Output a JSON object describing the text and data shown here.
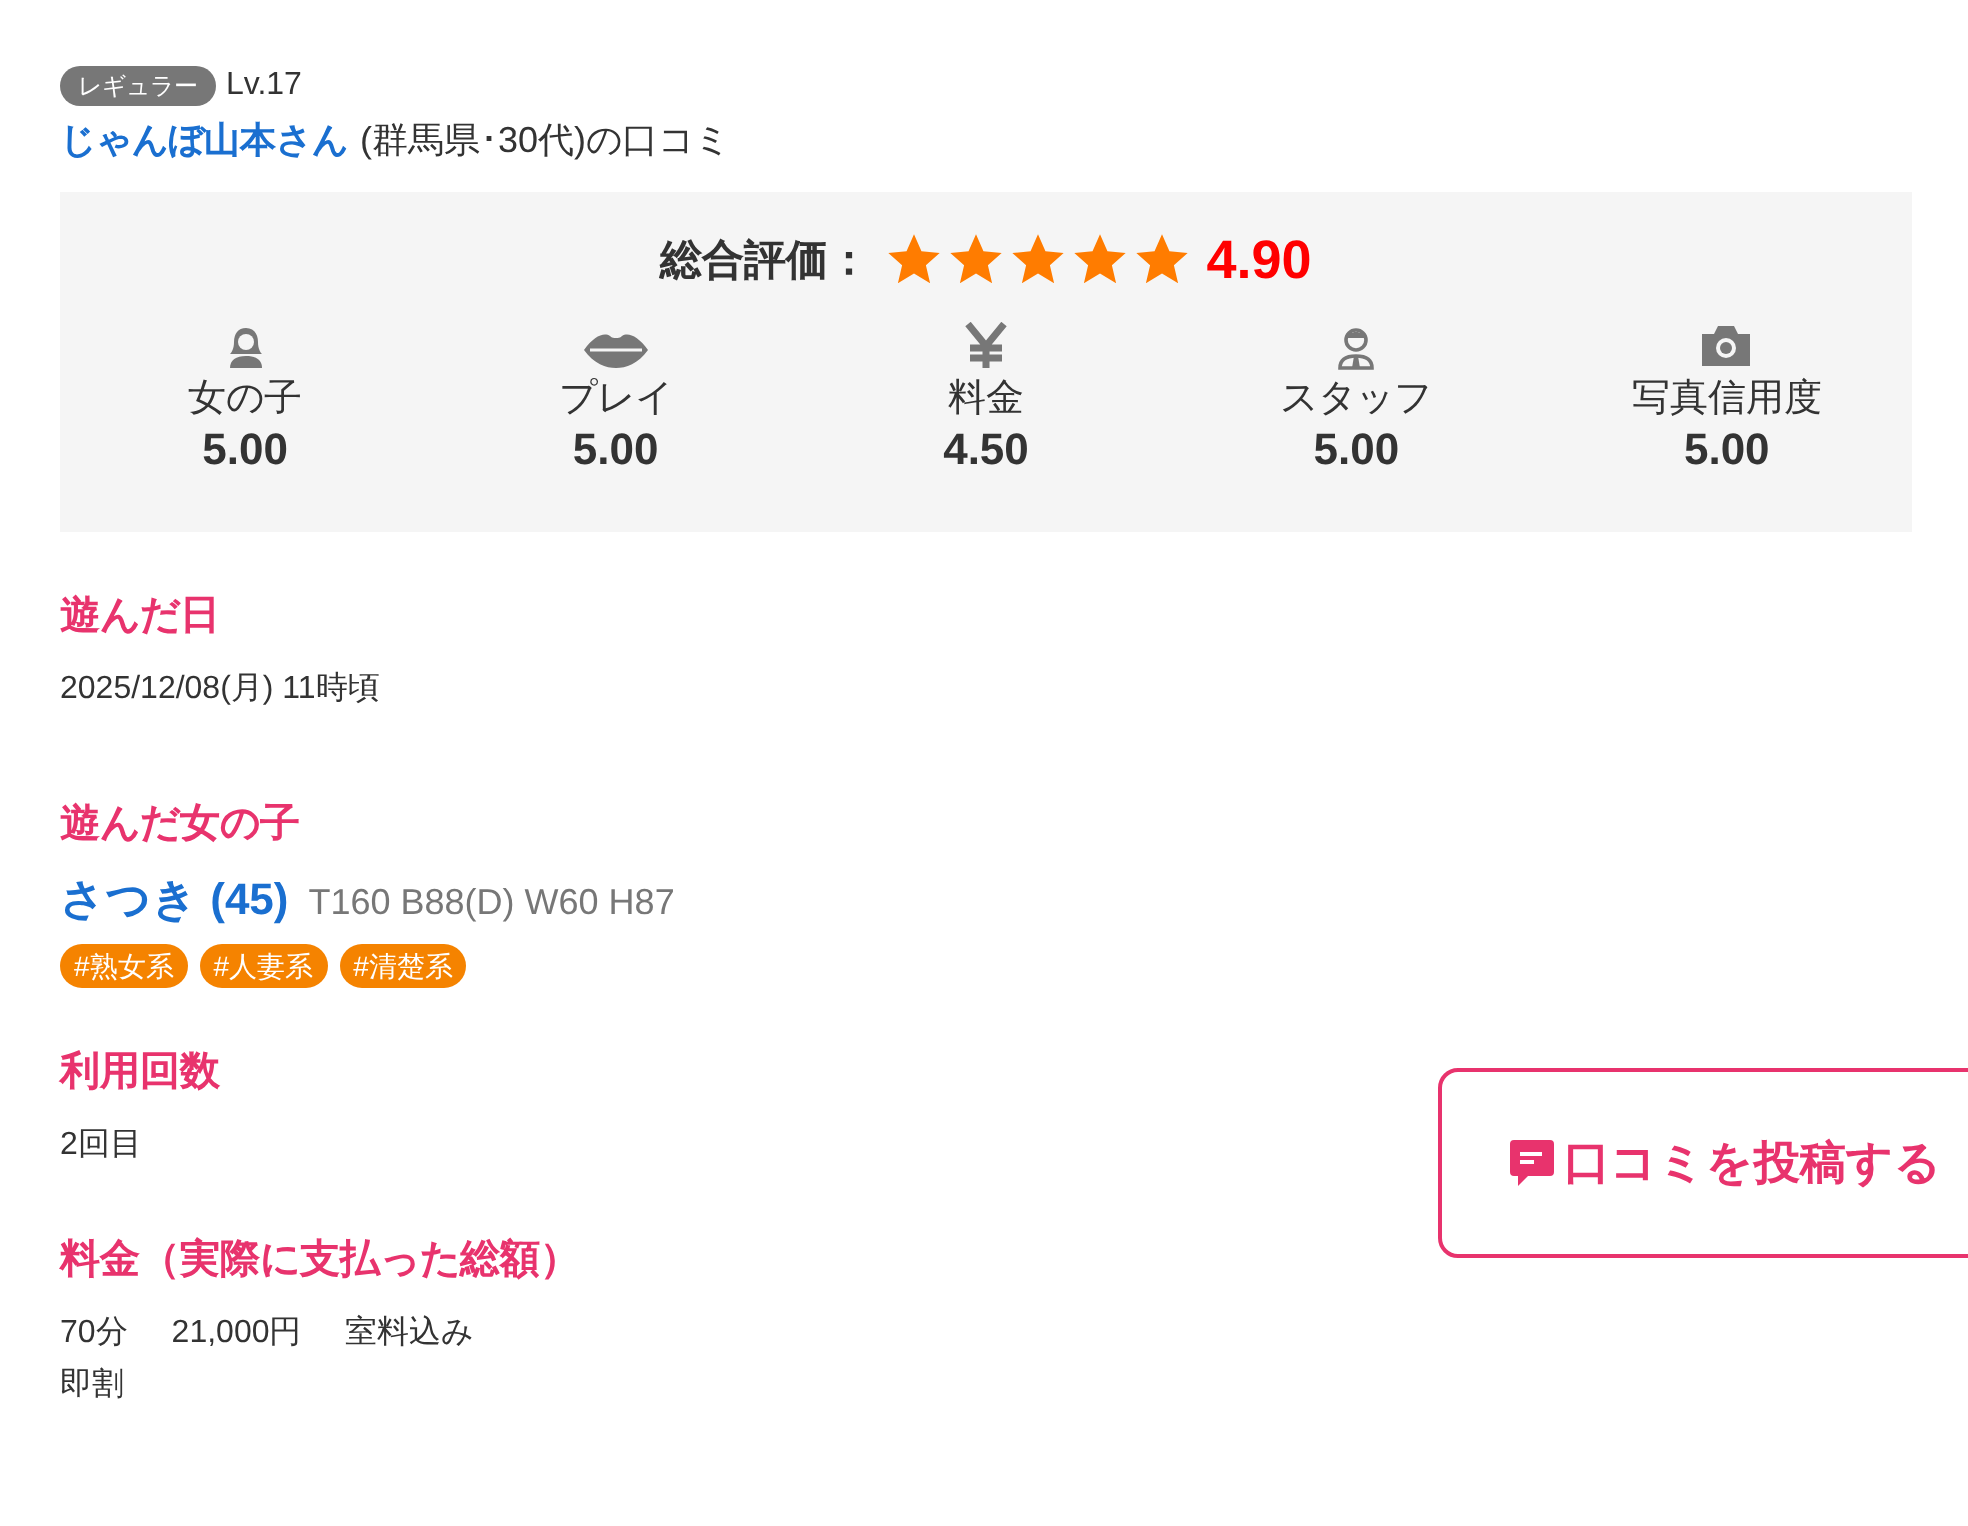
{
  "reviewer": {
    "rank_badge": "レギュラー",
    "level": "Lv.17",
    "name": "じゃんぼ山本さん",
    "profile": "(群馬県･30代)の口コミ"
  },
  "overall": {
    "label": "総合評価：",
    "stars": 5,
    "score": "4.90"
  },
  "categories": [
    {
      "kind": "girl",
      "label": "女の子",
      "score": "5.00"
    },
    {
      "kind": "lips",
      "label": "プレイ",
      "score": "5.00"
    },
    {
      "kind": "yen",
      "label": "料金",
      "score": "4.50"
    },
    {
      "kind": "staff",
      "label": "スタッフ",
      "score": "5.00"
    },
    {
      "kind": "camera",
      "label": "写真信用度",
      "score": "5.00"
    }
  ],
  "visit_date": {
    "heading": "遊んだ日",
    "value": "2025/12/08(月) 11時頃"
  },
  "girl": {
    "heading": "遊んだ女の子",
    "name": "さつき (45)",
    "measurements": "T160 B88(D) W60 H87",
    "tags": [
      "#熟女系",
      "#人妻系",
      "#清楚系"
    ]
  },
  "usage_count": {
    "heading": "利用回数",
    "value": "2回目"
  },
  "price": {
    "heading": "料金（実際に支払った総額）",
    "items": [
      "70分",
      "21,000円",
      "室料込み"
    ],
    "note": "即割"
  },
  "post_button": {
    "label": "口コミを投稿する"
  }
}
